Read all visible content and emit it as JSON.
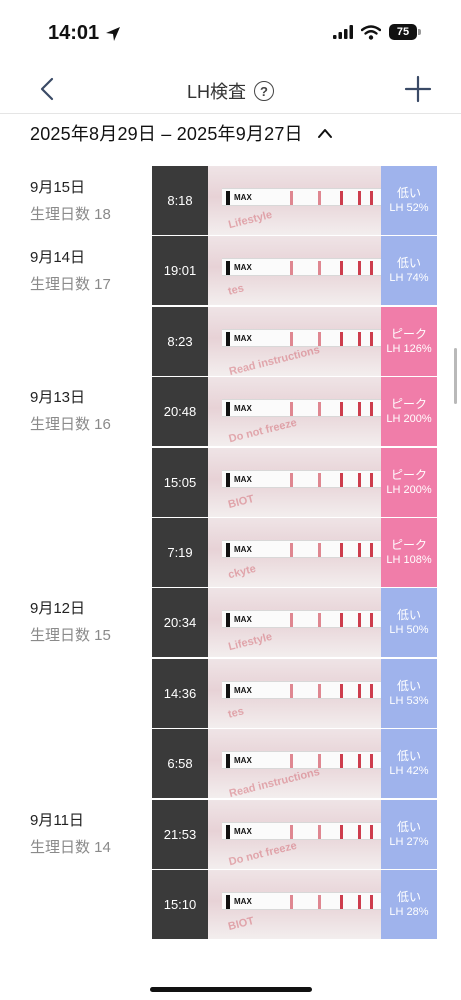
{
  "status_bar": {
    "time": "14:01",
    "battery": "75"
  },
  "nav": {
    "title": "LH検査",
    "help_symbol": "?"
  },
  "date_range": {
    "text": "2025年8月29日 – 2025年9月27日"
  },
  "days": [
    {
      "date": "9月15日",
      "cycle": "生理日数 18"
    },
    {
      "date": "9月14日",
      "cycle": "生理日数 17"
    },
    {
      "date": "9月13日",
      "cycle": "生理日数 16"
    },
    {
      "date": "9月12日",
      "cycle": "生理日数 15"
    },
    {
      "date": "9月11日",
      "cycle": "生理日数 14"
    }
  ],
  "entries": [
    {
      "time": "8:18",
      "result": "低い",
      "lh": "LH 52%",
      "level": "low"
    },
    {
      "time": "19:01",
      "result": "低い",
      "lh": "LH 74%",
      "level": "low"
    },
    {
      "time": "8:23",
      "result": "ピーク",
      "lh": "LH 126%",
      "level": "peak"
    },
    {
      "time": "20:48",
      "result": "ピーク",
      "lh": "LH 200%",
      "level": "peak"
    },
    {
      "time": "15:05",
      "result": "ピーク",
      "lh": "LH 200%",
      "level": "peak"
    },
    {
      "time": "7:19",
      "result": "ピーク",
      "lh": "LH 108%",
      "level": "peak"
    },
    {
      "time": "20:34",
      "result": "低い",
      "lh": "LH 50%",
      "level": "low"
    },
    {
      "time": "14:36",
      "result": "低い",
      "lh": "LH 53%",
      "level": "low"
    },
    {
      "time": "6:58",
      "result": "低い",
      "lh": "LH 42%",
      "level": "low"
    },
    {
      "time": "21:53",
      "result": "低い",
      "lh": "LH 27%",
      "level": "low"
    },
    {
      "time": "15:10",
      "result": "低い",
      "lh": "LH 28%",
      "level": "low"
    }
  ],
  "strip": {
    "max_label": "MAX"
  },
  "icons": {
    "back": "chevron-left-icon",
    "add": "plus-icon",
    "collapse": "chevron-up-icon",
    "help": "question-circle-icon"
  },
  "colors": {
    "low": "#9fb3ec",
    "peak": "#f07da9",
    "test_line": "#c8283a"
  }
}
